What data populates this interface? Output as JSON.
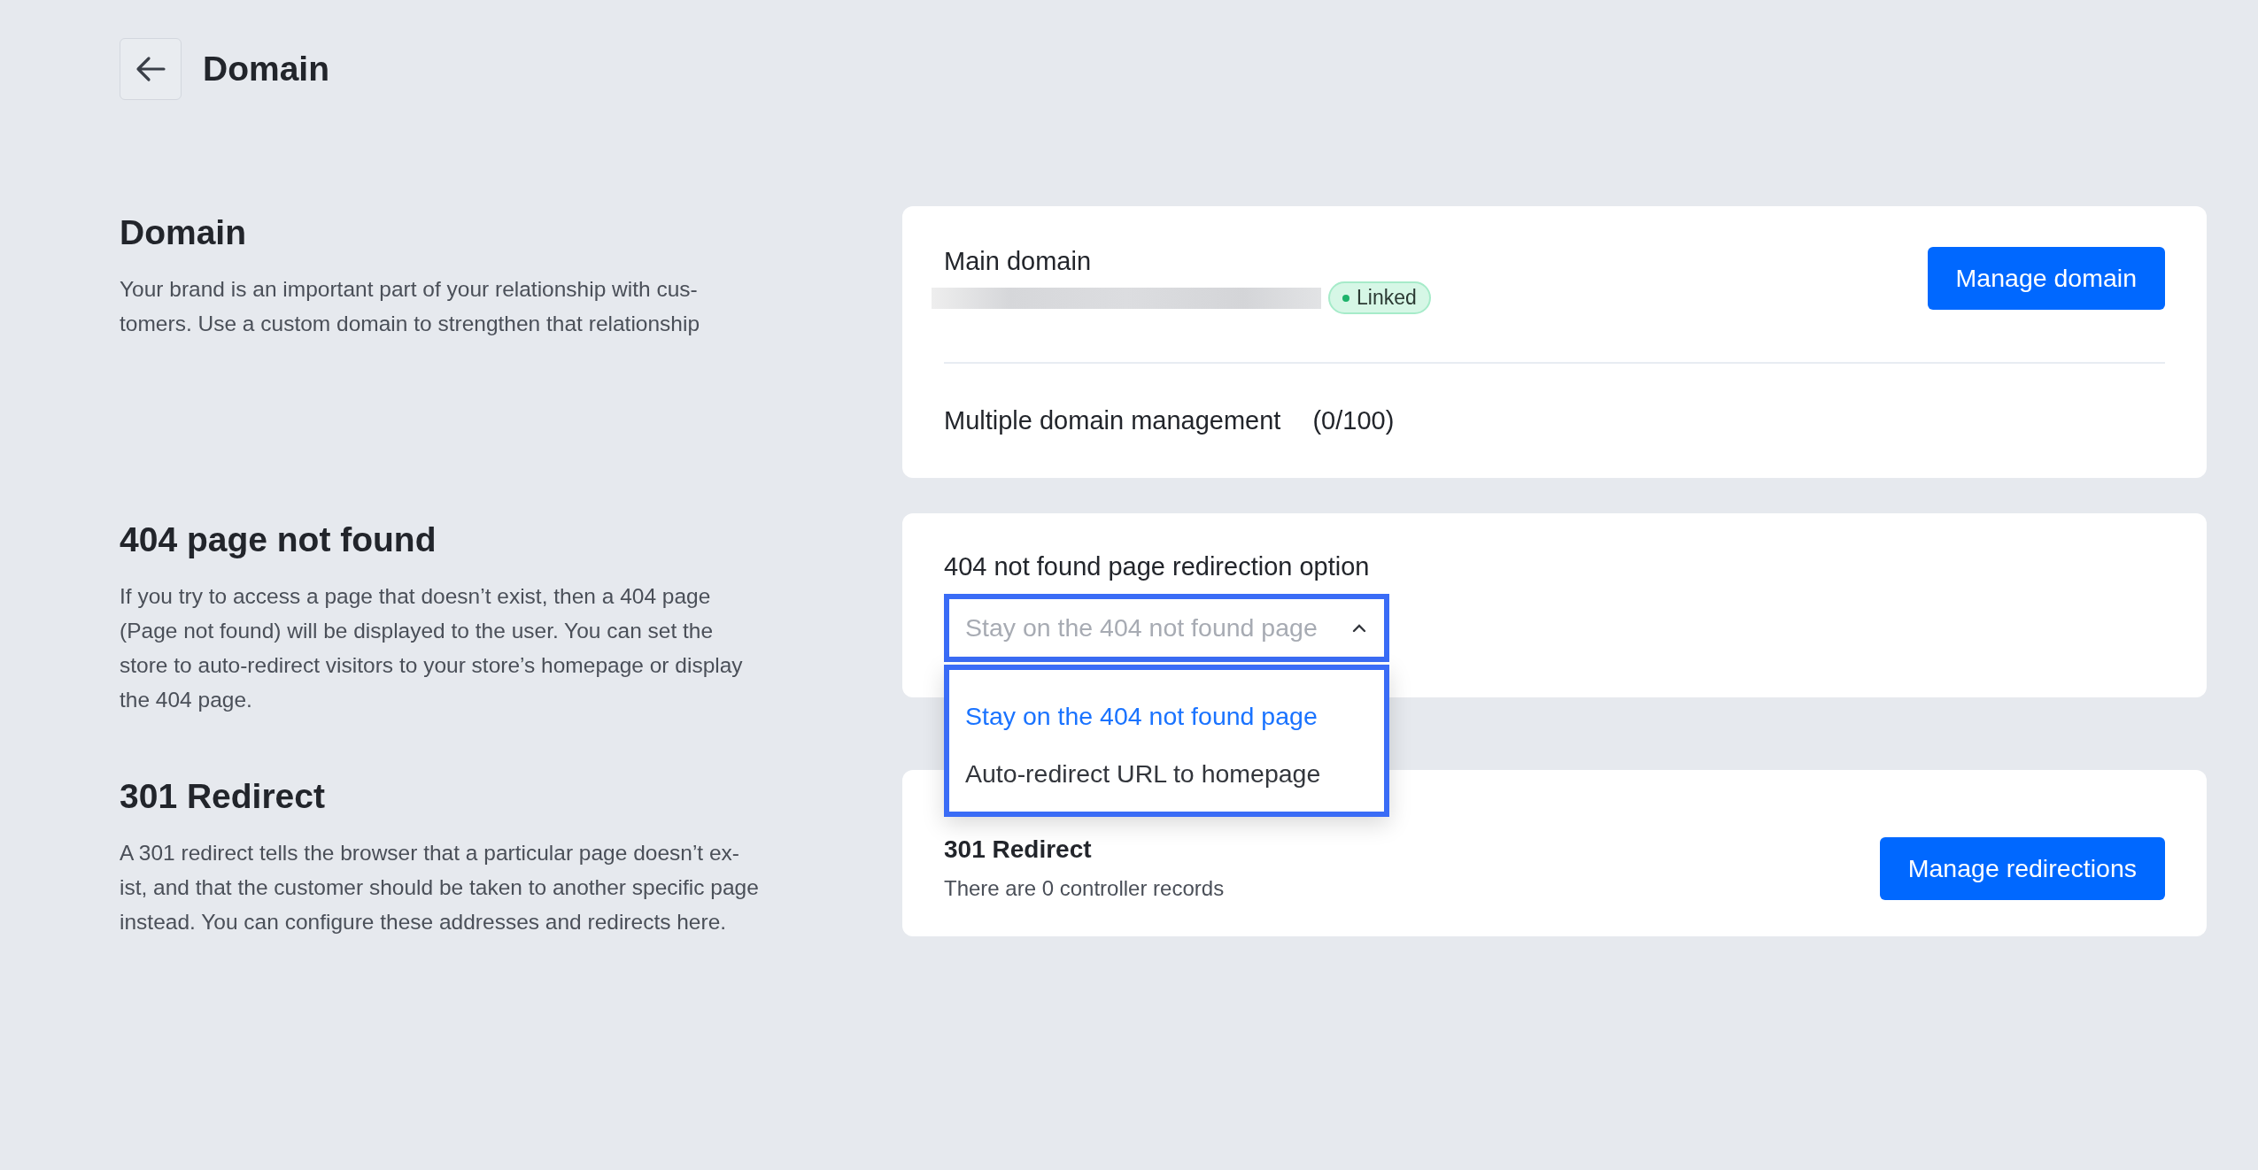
{
  "header": {
    "title": "Domain"
  },
  "sections": [
    {
      "kind": "domain",
      "heading": "Domain",
      "description": "Your brand is an important part of your relationship with cus-tomers. Use a custom domain to strengthen that relationship",
      "card": {
        "main_label": "Main domain",
        "status": "Linked",
        "button": "Manage domain",
        "multi_label": "Multiple domain management",
        "multi_count": "(0/100)"
      }
    },
    {
      "kind": "select",
      "heading": "404 page not found",
      "description": "If you try to access a page that doesn’t exist, then a 404 page (Page not found) will be displayed to the user. You can set the store to auto-redirect visitors to your store’s homepage or display the 404 page.",
      "card": {
        "label": "404 not found page redirection option",
        "value": "Stay on the 404 not found page",
        "expanded": true,
        "options": [
          {
            "label": "Stay on the 404 not found page",
            "selected": true
          },
          {
            "label": "Auto-redirect URL to homepage",
            "selected": false
          }
        ]
      }
    },
    {
      "kind": "redirect",
      "heading": "301 Redirect",
      "description": "A 301 redirect tells the browser that a particular page doesn’t ex-ist, and that the customer should be taken to another specific page instead. You can configure these addresses and redirects here.",
      "card": {
        "title": "301 Redirect",
        "note": "There are 0 controller records",
        "button": "Manage redirections"
      }
    }
  ]
}
